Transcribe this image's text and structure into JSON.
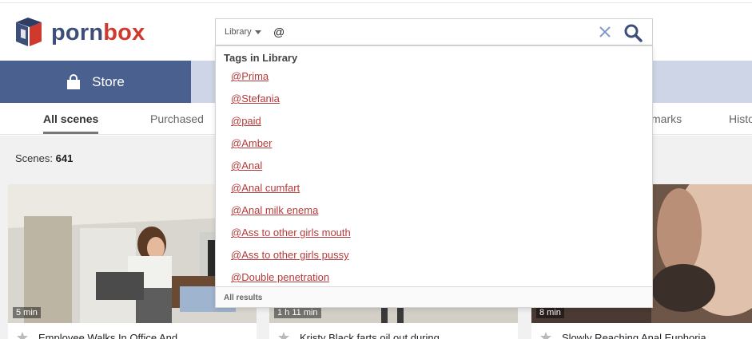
{
  "brand": {
    "name_part1": "porn",
    "name_part2": "box",
    "accent": "#d0392e",
    "primary": "#3d4f79"
  },
  "search": {
    "scope_label": "Library",
    "value": "@",
    "clear_icon": "close-icon",
    "submit_icon": "search-icon"
  },
  "nav": {
    "store_label": "Store",
    "store_icon": "shopping-bag-icon",
    "bar_color": "#4a6190"
  },
  "subtabs": [
    {
      "label": "All scenes",
      "active": true
    },
    {
      "label": "Purchased",
      "active": false
    },
    {
      "label": "marks",
      "active": false
    },
    {
      "label": "Histo",
      "active": false
    }
  ],
  "scenes": {
    "label": "Scenes:",
    "count": "641"
  },
  "dropdown": {
    "heading": "Tags in Library",
    "items": [
      "@Prima",
      "@Stefania",
      "@paid",
      "@Amber",
      "@Anal",
      "@Anal cumfart",
      "@Anal milk enema",
      "@Ass to other girls mouth",
      "@Ass to other girls pussy",
      "@Double penetration"
    ],
    "footer": "All results"
  },
  "cards": [
    {
      "duration": "5 min",
      "title": "Employee Walks In Office And"
    },
    {
      "duration": "1 h 11 min",
      "title": "Kristy Black farts oil out during"
    },
    {
      "duration": "8 min",
      "title": "Slowly Reaching Anal Euphoria"
    }
  ]
}
